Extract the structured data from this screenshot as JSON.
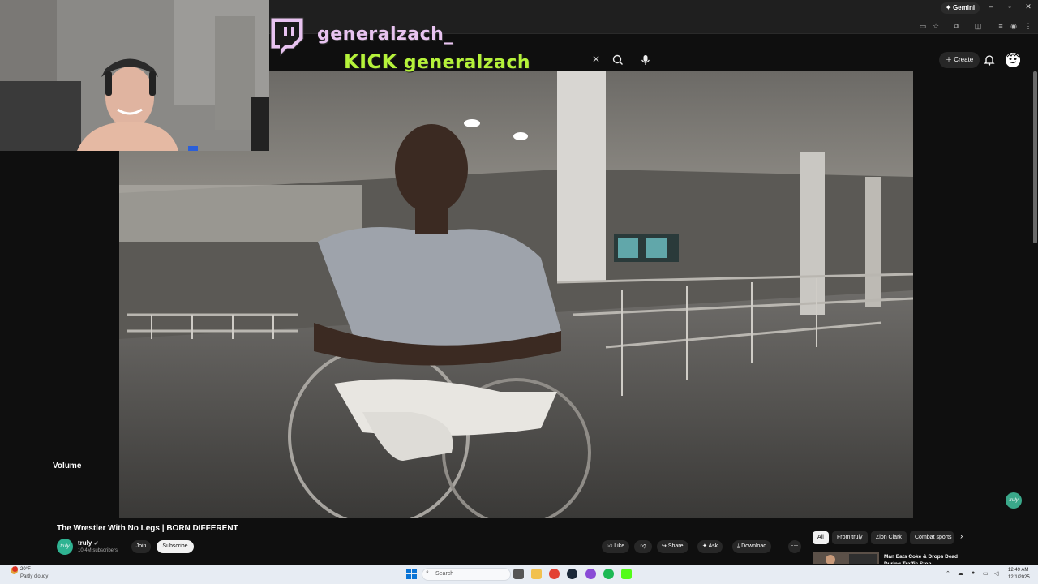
{
  "browser": {
    "gemini_label": "Gemini",
    "window_controls": [
      "–",
      "▫",
      "✕"
    ]
  },
  "overlay": {
    "twitch_handle": "generalzach_",
    "kick_word": "KICK",
    "kick_handle": "generalzach"
  },
  "youtube": {
    "create_label": "Create",
    "clear_icon": "✕",
    "player": {
      "volume_label": "Volume",
      "badge_label": "truly"
    },
    "video": {
      "title": "The Wrestler With No Legs | BORN DIFFERENT",
      "channel": "truly",
      "subscribers": "10.4M subscribers",
      "avatar_text": "truly"
    },
    "buttons": {
      "join": "Join",
      "subscribe": "Subscribe",
      "like": "Like",
      "share": "Share",
      "ask": "Ask",
      "download": "Download",
      "more": "···"
    },
    "chips": [
      "All",
      "From truly",
      "Zion Clark",
      "Combat sports"
    ],
    "chip_next": "›",
    "recommendation": {
      "title": "Man Eats Coke & Drops Dead During Traffic Stop",
      "more": "⋮"
    }
  },
  "taskbar": {
    "weather_temp": "20°F",
    "weather_desc": "Partly cloudy",
    "weather_alert": "1",
    "search_placeholder": "Search",
    "time": "12:49 AM",
    "date": "12/1/2025"
  },
  "colors": {
    "twitch_overlay": "#e8c3f0",
    "kick_overlay": "#b5f23a",
    "youtube_bg": "#0f0f0f",
    "taskbar_bg": "#e7ecf3",
    "channel_brand": "#2fb392"
  }
}
